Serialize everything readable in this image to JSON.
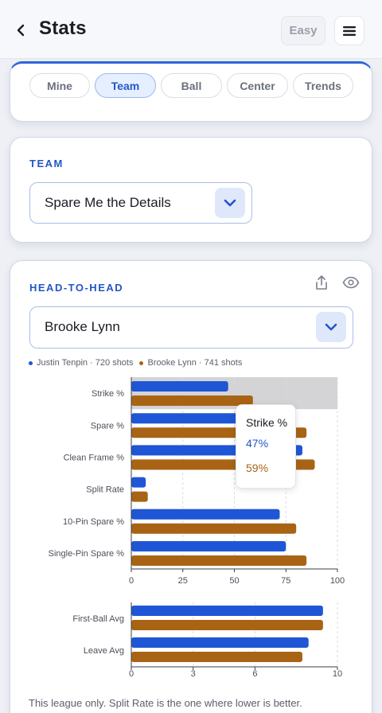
{
  "header": {
    "back_icon": "chevron-left-icon",
    "title": "Stats",
    "easy_label": "Easy",
    "menu_icon": "hamburger-menu-icon"
  },
  "tabs": [
    {
      "label": "Mine",
      "active": false
    },
    {
      "label": "Team",
      "active": true
    },
    {
      "label": "Ball",
      "active": false
    },
    {
      "label": "Center",
      "active": false
    },
    {
      "label": "Trends",
      "active": false
    }
  ],
  "team": {
    "label": "TEAM",
    "selected": "Spare Me the Details"
  },
  "h2h": {
    "label": "HEAD-TO-HEAD",
    "share_icon": "share-icon",
    "eye_icon": "eye-icon",
    "selected": "Brooke Lynn",
    "legend": [
      {
        "text": "Justin Tenpin · 720 shots",
        "color": "#1f56d6"
      },
      {
        "text": "Brooke Lynn · 741 shots",
        "color": "#a86414"
      }
    ],
    "tooltip": {
      "title": "Strike %",
      "v1": "47%",
      "v2": "59%"
    },
    "footnote": "This league only. Split Rate is the one where lower is better."
  },
  "chart_data": [
    {
      "type": "bar",
      "orientation": "horizontal",
      "categories": [
        "Strike %",
        "Spare %",
        "Clean Frame %",
        "Split Rate",
        "10-Pin Spare %",
        "Single-Pin Spare %"
      ],
      "series": [
        {
          "name": "Justin Tenpin",
          "values": [
            47,
            73,
            83,
            7,
            72,
            75
          ]
        },
        {
          "name": "Brooke Lynn",
          "values": [
            59,
            85,
            89,
            8,
            80,
            85
          ]
        }
      ],
      "xlim": [
        0,
        100
      ],
      "xticks": [
        0,
        25,
        50,
        75,
        100
      ],
      "grid": true,
      "highlight": "Strike %"
    },
    {
      "type": "bar",
      "orientation": "horizontal",
      "categories": [
        "First-Ball Avg",
        "Leave Avg"
      ],
      "series": [
        {
          "name": "Justin Tenpin",
          "values": [
            9.3,
            8.6
          ]
        },
        {
          "name": "Brooke Lynn",
          "values": [
            9.3,
            8.3
          ]
        }
      ],
      "xlim": [
        0,
        10
      ],
      "xticks": [
        0,
        3,
        6,
        10
      ],
      "grid": true
    }
  ],
  "colors": {
    "series1": "#1f56d6",
    "series2": "#a86414",
    "accent": "#2356c7"
  }
}
